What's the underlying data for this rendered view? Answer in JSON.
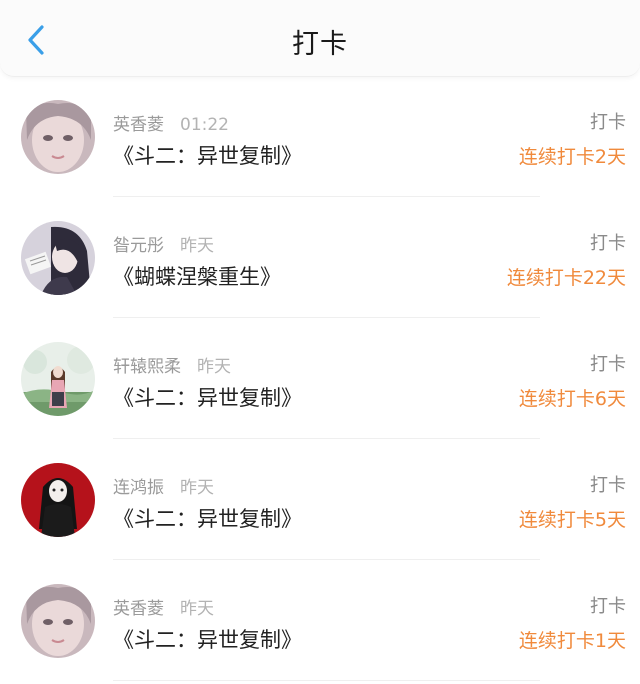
{
  "header": {
    "title": "打卡",
    "back_icon": "chevron-left-icon",
    "accent_color": "#3a9fe8"
  },
  "entries": [
    {
      "name": "英香菱",
      "time": "01:22",
      "book": "《斗二：异世复制》",
      "action": "打卡",
      "streak": "连续打卡2天",
      "avatar": "pale-girl-portrait"
    },
    {
      "name": "昝元彤",
      "time": "昨天",
      "book": "《蝴蝶涅槃重生》",
      "action": "打卡",
      "streak": "连续打卡22天",
      "avatar": "reading-girl"
    },
    {
      "name": "轩辕熙柔",
      "time": "昨天",
      "book": "《斗二：异世复制》",
      "action": "打卡",
      "streak": "连续打卡6天",
      "avatar": "girl-in-landscape"
    },
    {
      "name": "连鸿振",
      "time": "昨天",
      "book": "《斗二：异世复制》",
      "action": "打卡",
      "streak": "连续打卡5天",
      "avatar": "black-haired-girl-red"
    },
    {
      "name": "英香菱",
      "time": "昨天",
      "book": "《斗二：异世复制》",
      "action": "打卡",
      "streak": "连续打卡1天",
      "avatar": "pale-girl-portrait"
    }
  ],
  "colors": {
    "streak": "#f08a3c",
    "meta": "#9a9a9a"
  }
}
